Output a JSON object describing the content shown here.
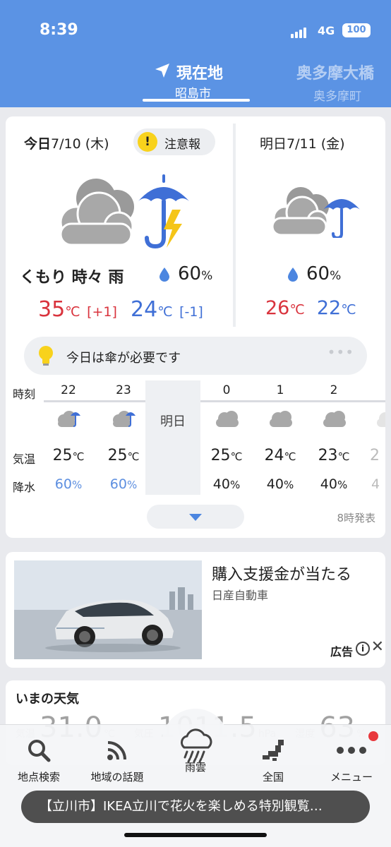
{
  "status_bar": {
    "time": "8:39",
    "network": "4G",
    "battery": "100"
  },
  "locations": {
    "current": {
      "name": "現在地",
      "sub": "昭島市"
    },
    "next": {
      "name": "奥多摩大橋",
      "sub": "奥多摩町"
    }
  },
  "today": {
    "label": "今日",
    "date": "7/10",
    "weekday": "(木)",
    "warning": "注意報",
    "condition": "くもり 時々 雨",
    "precip": "60",
    "precip_unit": "%",
    "high": "35",
    "high_diff": "[+1]",
    "low": "24",
    "low_diff": "[-1]",
    "temp_unit": "℃"
  },
  "tomorrow": {
    "label": "明日",
    "date": "7/11",
    "weekday": "(金)",
    "precip": "60",
    "precip_unit": "%",
    "high": "26",
    "low": "22",
    "temp_unit": "℃"
  },
  "tip": {
    "text": "今日は傘が必要です",
    "more": "•••"
  },
  "hourly": {
    "labels": {
      "time": "時刻",
      "temp": "気温",
      "precip": "降水"
    },
    "tomorrow_marker": "明日",
    "hours": [
      {
        "hour": "22",
        "icon": "cloud-umbrella-icon",
        "temp": "25",
        "precip": "60"
      },
      {
        "hour": "23",
        "icon": "cloud-umbrella-icon",
        "temp": "25",
        "precip": "60"
      },
      {
        "hour": "0",
        "icon": "cloud-icon",
        "temp": "25",
        "precip": "40"
      },
      {
        "hour": "1",
        "icon": "cloud-icon",
        "temp": "24",
        "precip": "40"
      },
      {
        "hour": "2",
        "icon": "cloud-icon",
        "temp": "23",
        "precip": "40"
      },
      {
        "hour": "",
        "icon": "cloud-icon",
        "temp": "2",
        "precip": "4"
      }
    ],
    "temp_unit": "℃",
    "precip_unit": "%",
    "issued": "8時発表"
  },
  "ad": {
    "title": "購入支援金が当たる",
    "sponsor": "日産自動車",
    "label": "広告",
    "info": "i",
    "close": "✕"
  },
  "now": {
    "title": "いまの天気",
    "items": [
      {
        "label": "気温",
        "value": "31.0",
        "unit": "℃"
      },
      {
        "label": "気圧",
        "value": "1011.5",
        "unit": "hPa"
      },
      {
        "label": "湿度",
        "value": "63",
        "unit": "%"
      }
    ]
  },
  "tabs": [
    {
      "label": "地点検索",
      "icon": "search-icon"
    },
    {
      "label": "地域の話題",
      "icon": "broadcast-icon"
    },
    {
      "label": "雨雲",
      "icon": "rain-cloud-icon"
    },
    {
      "label": "全国",
      "icon": "japan-map-icon"
    },
    {
      "label": "メニュー",
      "icon": "more-icon"
    }
  ],
  "ticker": "【立川市】IKEA立川で花火を楽しめる特別観覧…",
  "colors": {
    "header": "#5b93e4",
    "high": "#d9333d",
    "low": "#3f6fd6",
    "umbrella": "#3f6fd6",
    "lightning": "#f5c518"
  }
}
